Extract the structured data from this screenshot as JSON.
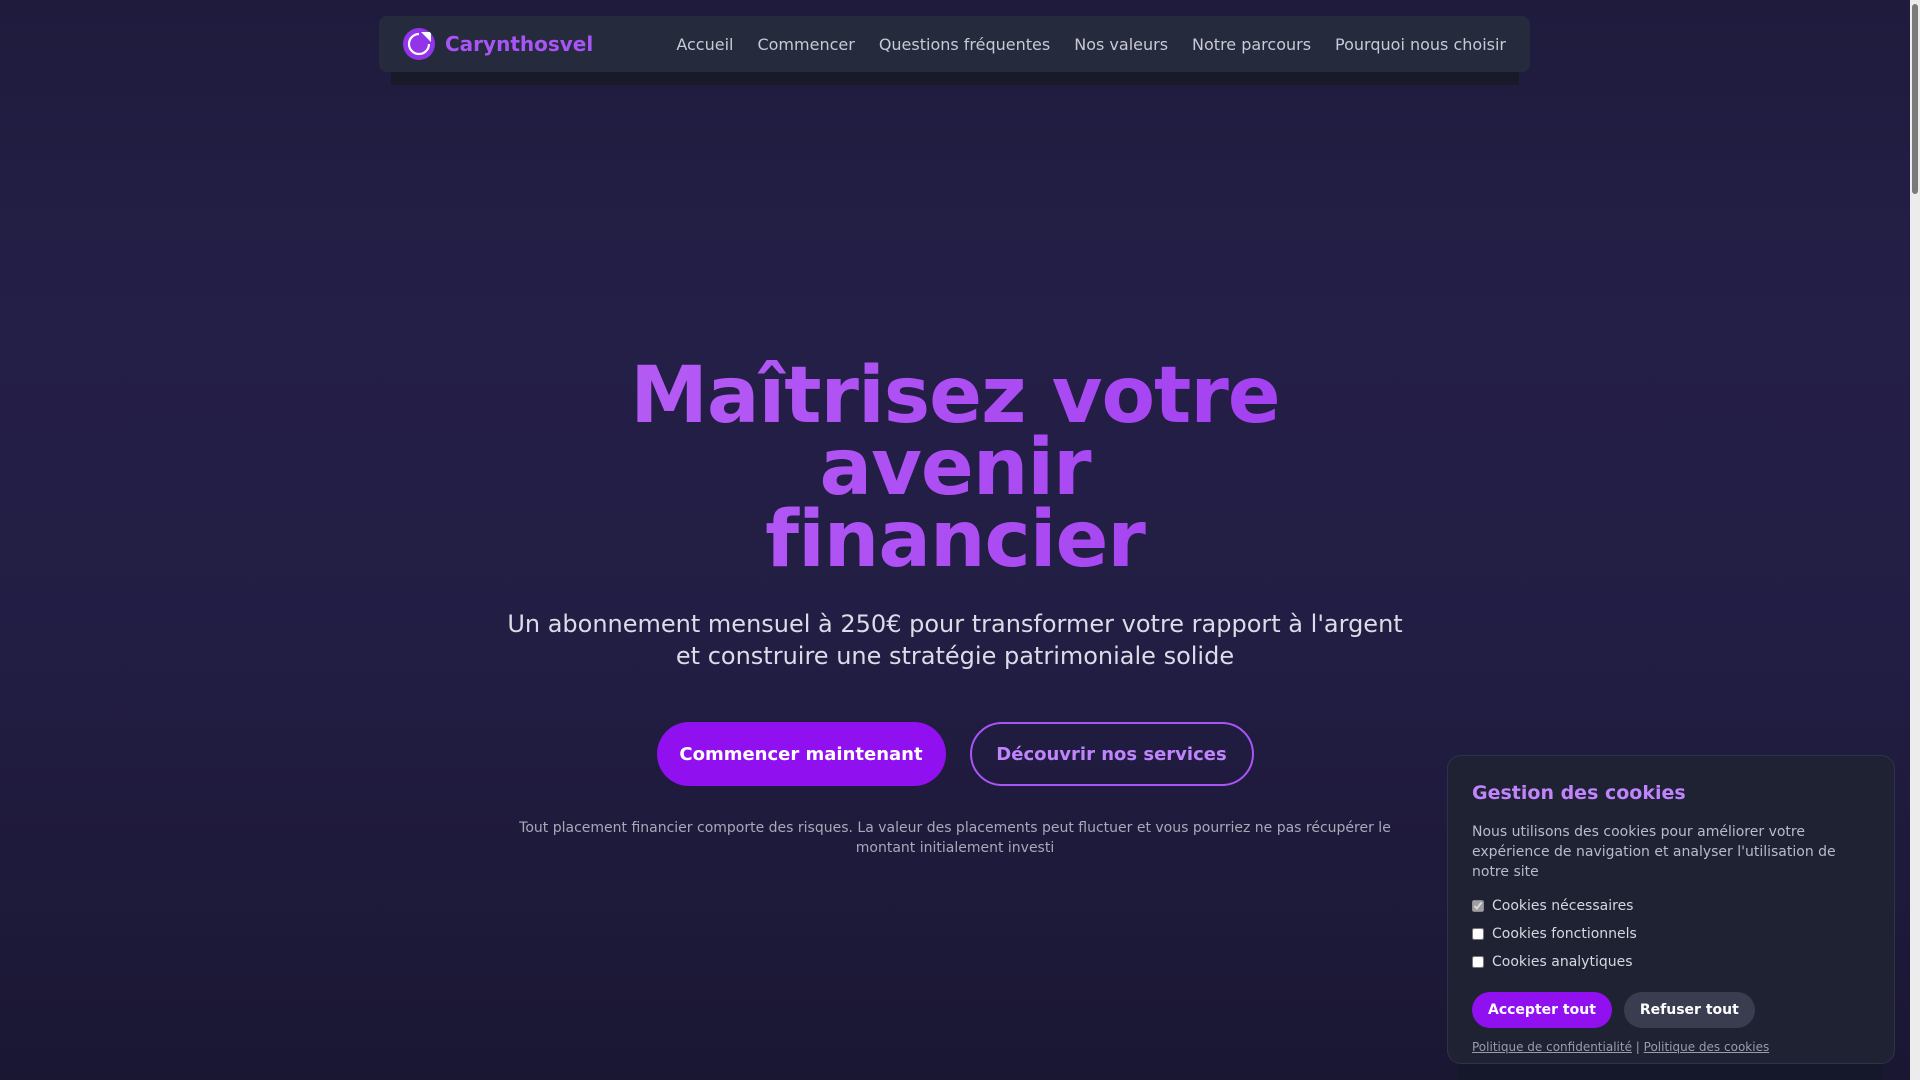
{
  "brand": {
    "name": "Carynthosvel",
    "logo_icon": "chart-pie-icon"
  },
  "nav": {
    "links": [
      "Accueil",
      "Commencer",
      "Questions fréquentes",
      "Nos valeurs",
      "Notre parcours",
      "Pourquoi nous choisir"
    ]
  },
  "hero": {
    "title_line1": "Maîtrisez votre avenir",
    "title_line2": "financier",
    "subtitle": "Un abonnement mensuel à 250€ pour transformer votre rapport à l'argent et construire une stratégie patrimoniale solide",
    "primary_cta": "Commencer maintenant",
    "secondary_cta": "Découvrir nos services",
    "risk_note": "Tout placement financier comporte des risques. La valeur des placements peut fluctuer et vous pourriez ne pas récupérer le montant initialement investi"
  },
  "cookies": {
    "title": "Gestion des cookies",
    "description": "Nous utilisons des cookies pour améliorer votre expérience de navigation et analyser l'utilisation de notre site",
    "options": [
      {
        "label": "Cookies nécessaires",
        "checked": true,
        "disabled": true
      },
      {
        "label": "Cookies fonctionnels",
        "checked": false,
        "disabled": false
      },
      {
        "label": "Cookies analytiques",
        "checked": false,
        "disabled": false
      }
    ],
    "accept_label": "Accepter tout",
    "refuse_label": "Refuser tout",
    "privacy_link": "Politique de confidentialité",
    "separator": "|",
    "cookie_policy_link": "Politique des cookies"
  },
  "colors": {
    "accent": "#9110f0",
    "accent_light": "#a855f7",
    "background": "#221d43",
    "nav_bg": "#252a3d"
  }
}
